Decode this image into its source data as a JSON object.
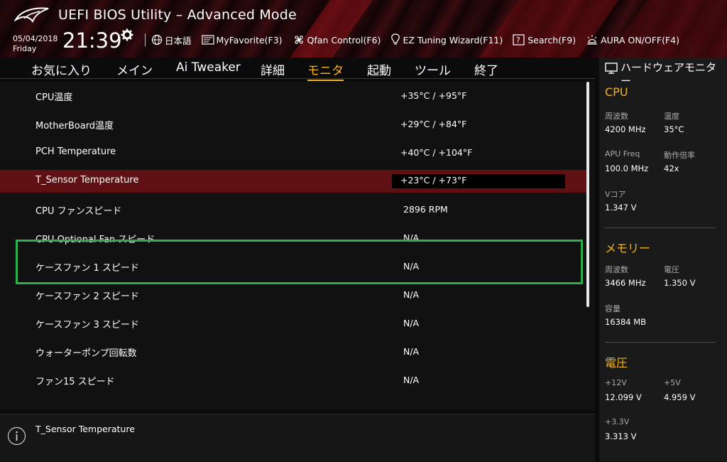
{
  "header": {
    "title": "UEFI BIOS Utility – Advanced Mode",
    "date": "05/04/2018",
    "day": "Friday",
    "time": "21:39",
    "toolbar": [
      {
        "label": "日本語",
        "icon": "globe-icon"
      },
      {
        "label": "MyFavorite(F3)",
        "icon": "favorite-icon"
      },
      {
        "label": "Qfan Control(F6)",
        "icon": "fan-icon"
      },
      {
        "label": "EZ Tuning Wizard(F11)",
        "icon": "lightbulb-icon"
      },
      {
        "label": "Search(F9)",
        "icon": "search-icon"
      },
      {
        "label": "AURA ON/OFF(F4)",
        "icon": "aura-icon"
      }
    ]
  },
  "menu": {
    "tabs": [
      "お気に入り",
      "メイン",
      "Ai Tweaker",
      "詳細",
      "モニタ",
      "起動",
      "ツール",
      "終了"
    ],
    "active": "モニタ"
  },
  "rows": [
    {
      "label": "CPU温度",
      "value": "+35°C / +95°F"
    },
    {
      "label": "MotherBoard温度",
      "value": "+29°C / +84°F"
    },
    {
      "label": "PCH Temperature",
      "value": "+40°C / +104°F"
    },
    {
      "label": "T_Sensor Temperature",
      "value": "+23°C / +73°F"
    },
    {
      "label": "CPU ファンスピード",
      "value": "2896 RPM"
    },
    {
      "label": "CPU Optional Fan スピード",
      "value": "N/A"
    },
    {
      "label": "ケースファン 1 スピード",
      "value": "N/A"
    },
    {
      "label": "ケースファン 2 スピード",
      "value": "N/A"
    },
    {
      "label": "ケースファン 3 スピード",
      "value": "N/A"
    },
    {
      "label": "ウォーターポンプ回転数",
      "value": "N/A"
    },
    {
      "label": "ファン15 スピード",
      "value": "N/A"
    }
  ],
  "help": {
    "text": "T_Sensor Temperature"
  },
  "monitor": {
    "title": "ハードウェアモニター",
    "cpu": {
      "heading": "CPU",
      "freq_label": "周波数",
      "freq": "4200 MHz",
      "temp_label": "温度",
      "temp": "35°C",
      "apu_label": "APU Freq",
      "apu": "100.0 MHz",
      "ratio_label": "動作倍率",
      "ratio": "42x",
      "vcore_label": "Vコア",
      "vcore": "1.347 V"
    },
    "memory": {
      "heading": "メモリー",
      "freq_label": "周波数",
      "freq": "3466 MHz",
      "volt_label": "電圧",
      "volt": "1.350 V",
      "cap_label": "容量",
      "cap": "16384 MB"
    },
    "voltage": {
      "heading": "電圧",
      "v12_label": "+12V",
      "v12": "12.099 V",
      "v5_label": "+5V",
      "v5": "4.959 V",
      "v33_label": "+3.3V",
      "v33": "3.313 V"
    }
  },
  "colors": {
    "accent": "#f5b31b",
    "selected_row": "#5e1012",
    "highlight_box": "#2bb04a"
  }
}
